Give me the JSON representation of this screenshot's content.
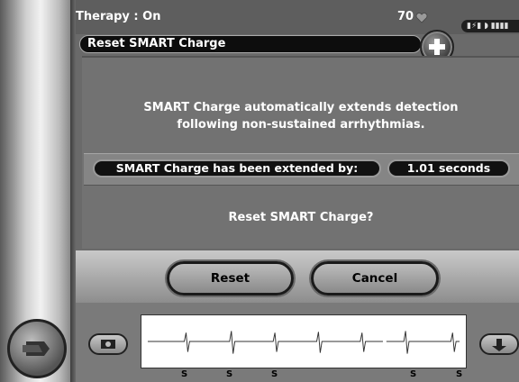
{
  "header": {
    "therapy_status": "Therapy : On",
    "heart_rate": "70",
    "status_strip": "▮⚡▮ ◗ ▮▮▮▮"
  },
  "dialog": {
    "title": "Reset SMART Charge",
    "description_line1": "SMART Charge automatically extends detection",
    "description_line2": "following non-sustained arrhythmias.",
    "extended_label": "SMART Charge has been extended by:",
    "extended_value": "1.01 seconds",
    "question": "Reset SMART Charge?",
    "reset_label": "Reset",
    "cancel_label": "Cancel"
  },
  "ecg": {
    "markers": [
      "S",
      "S",
      "S",
      "S",
      "S"
    ]
  },
  "colors": {
    "panel": "#727272",
    "title_bar": "#0d0d0d",
    "button": "#a5a5a5"
  }
}
